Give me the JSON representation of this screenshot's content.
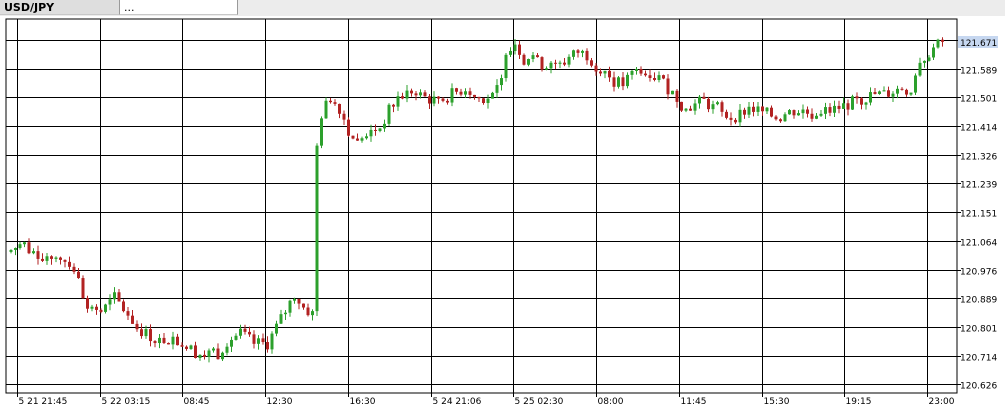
{
  "tabs": [
    {
      "label": "USD/JPY"
    },
    {
      "label": "..."
    }
  ],
  "colors": {
    "up": "#2ca02c",
    "down": "#b22222",
    "grid": "#000000",
    "background": "#ffffff",
    "current_price_bg": "#c6d7f0"
  },
  "chart_data": {
    "type": "candlestick",
    "symbol": "USD/JPY",
    "ylim": [
      120.6,
      121.74
    ],
    "grid": true,
    "y_ticks": [
      "121.676",
      "121.589",
      "121.501",
      "121.414",
      "121.326",
      "121.239",
      "121.151",
      "121.064",
      "120.976",
      "120.889",
      "120.801",
      "120.714",
      "120.626"
    ],
    "current_price": "121.671",
    "x_ticks": [
      "5 21 21:45",
      "5 22 03:15",
      "08:45",
      "12:30",
      "16:30",
      "5 24 21:06",
      "5 25 02:30",
      "08:00",
      "11:45",
      "15:30",
      "19:15",
      "23:00"
    ],
    "path_points": [
      [
        0,
        121.03
      ],
      [
        2,
        121.05
      ],
      [
        5,
        121.03
      ],
      [
        8,
        121.02
      ],
      [
        12,
        121.01
      ],
      [
        14,
        120.98
      ],
      [
        16,
        120.9
      ],
      [
        18,
        120.85
      ],
      [
        21,
        120.86
      ],
      [
        23,
        120.89
      ],
      [
        26,
        120.84
      ],
      [
        28,
        120.8
      ],
      [
        30,
        120.78
      ],
      [
        33,
        120.76
      ],
      [
        36,
        120.77
      ],
      [
        39,
        120.74
      ],
      [
        42,
        120.72
      ],
      [
        46,
        120.72
      ],
      [
        48,
        120.76
      ],
      [
        51,
        120.78
      ],
      [
        54,
        120.75
      ],
      [
        57,
        120.75
      ],
      [
        59,
        120.8
      ],
      [
        61,
        120.85
      ],
      [
        63,
        120.9
      ],
      [
        65,
        120.86
      ],
      [
        67,
        120.84
      ],
      [
        68,
        121.35
      ],
      [
        69,
        121.45
      ],
      [
        71,
        121.5
      ],
      [
        73,
        121.47
      ],
      [
        75,
        121.4
      ],
      [
        77,
        121.36
      ],
      [
        79,
        121.39
      ],
      [
        82,
        121.41
      ],
      [
        84,
        121.46
      ],
      [
        86,
        121.5
      ],
      [
        89,
        121.52
      ],
      [
        92,
        121.5
      ],
      [
        95,
        121.49
      ],
      [
        98,
        121.51
      ],
      [
        101,
        121.53
      ],
      [
        104,
        121.5
      ],
      [
        107,
        121.5
      ],
      [
        109,
        121.55
      ],
      [
        110,
        121.65
      ],
      [
        112,
        121.67
      ],
      [
        114,
        121.62
      ],
      [
        116,
        121.63
      ],
      [
        118,
        121.6
      ],
      [
        120,
        121.61
      ],
      [
        122,
        121.6
      ],
      [
        124,
        121.62
      ],
      [
        126,
        121.64
      ],
      [
        128,
        121.63
      ],
      [
        130,
        121.6
      ],
      [
        132,
        121.58
      ],
      [
        134,
        121.55
      ],
      [
        136,
        121.54
      ],
      [
        138,
        121.57
      ],
      [
        140,
        121.59
      ],
      [
        142,
        121.58
      ],
      [
        144,
        121.56
      ],
      [
        146,
        121.53
      ],
      [
        148,
        121.5
      ],
      [
        150,
        121.46
      ],
      [
        152,
        121.48
      ],
      [
        154,
        121.49
      ],
      [
        156,
        121.47
      ],
      [
        158,
        121.45
      ],
      [
        160,
        121.44
      ],
      [
        162,
        121.45
      ],
      [
        164,
        121.47
      ],
      [
        166,
        121.46
      ],
      [
        168,
        121.45
      ],
      [
        170,
        121.44
      ],
      [
        172,
        121.45
      ],
      [
        174,
        121.46
      ],
      [
        176,
        121.46
      ],
      [
        178,
        121.45
      ],
      [
        180,
        121.46
      ],
      [
        182,
        121.46
      ],
      [
        184,
        121.47
      ],
      [
        186,
        121.48
      ],
      [
        188,
        121.49
      ],
      [
        190,
        121.5
      ],
      [
        192,
        121.51
      ],
      [
        194,
        121.51
      ],
      [
        196,
        121.52
      ],
      [
        198,
        121.53
      ],
      [
        200,
        121.52
      ],
      [
        201,
        121.55
      ],
      [
        202,
        121.6
      ],
      [
        204,
        121.64
      ],
      [
        206,
        121.66
      ],
      [
        207,
        121.67
      ]
    ]
  }
}
